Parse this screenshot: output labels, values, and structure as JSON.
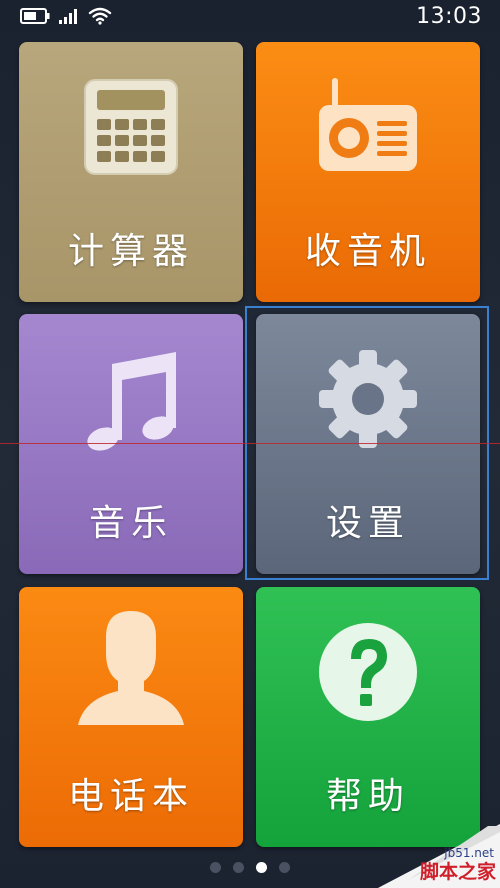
{
  "status_bar": {
    "time": "13:03",
    "icons": [
      "battery-icon",
      "signal-icon",
      "wifi-icon"
    ]
  },
  "tiles": [
    {
      "label": "计算器",
      "icon": "calculator-icon",
      "color": "#b3a173"
    },
    {
      "label": "收音机",
      "icon": "radio-icon",
      "color": "#f37b0b"
    },
    {
      "label": "音乐",
      "icon": "music-note-icon",
      "color": "#9a7ac5"
    },
    {
      "label": "设置",
      "icon": "gear-icon",
      "color": "#6b7589"
    },
    {
      "label": "电话本",
      "icon": "contact-person-icon",
      "color": "#f37a0b"
    },
    {
      "label": "帮助",
      "icon": "help-question-icon",
      "color": "#23b048"
    }
  ],
  "selected_tile": "设置",
  "pager": {
    "count": 4,
    "active_index": 2
  },
  "watermark": {
    "url": "jb51.net",
    "name": "脚本之家"
  }
}
